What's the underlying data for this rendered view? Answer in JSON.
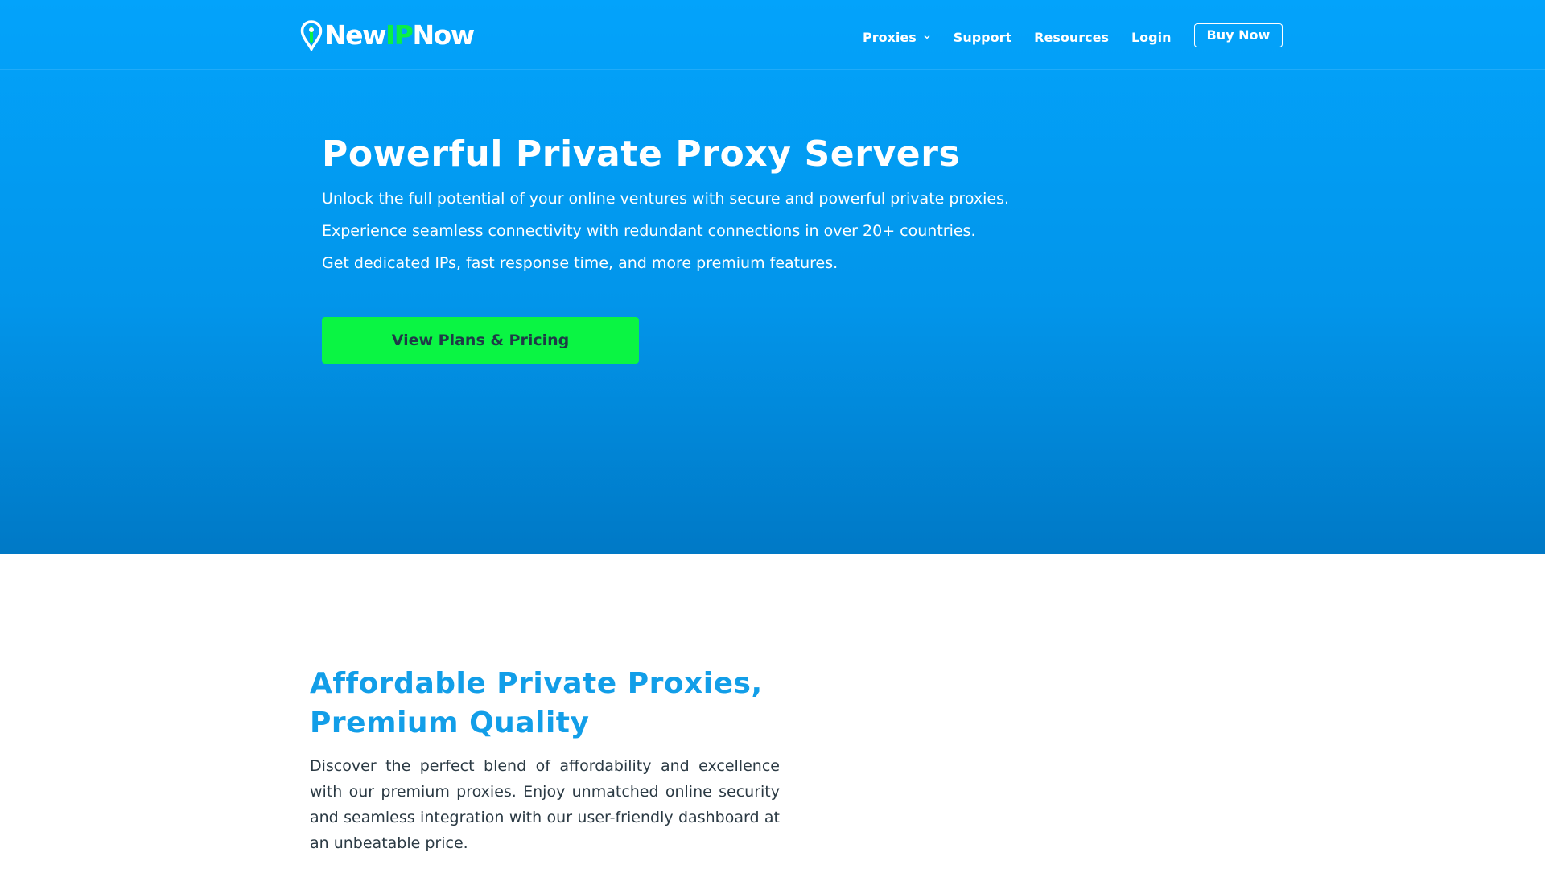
{
  "brand": {
    "name_prefix": "New",
    "name_highlight": "IP",
    "name_suffix": "Now",
    "icon": "map-pin-icon",
    "colors": {
      "primary": "#03a3fb",
      "accent": "#0aef46",
      "heading_blue": "#129ee8"
    }
  },
  "nav": {
    "items": [
      {
        "label": "Proxies",
        "has_dropdown": true
      },
      {
        "label": "Support"
      },
      {
        "label": "Resources"
      },
      {
        "label": "Login"
      }
    ],
    "buy_label": "Buy Now"
  },
  "hero": {
    "title": "Powerful Private Proxy Servers",
    "lines": [
      "Unlock the full potential of your online ventures with secure and powerful private proxies.",
      "Experience seamless connectivity with redundant connections in over 20+ countries.",
      "Get dedicated IPs, fast response time, and more premium features."
    ],
    "cta_label": "View Plans & Pricing"
  },
  "section": {
    "title": "Affordable Private Proxies, Premium Quality",
    "body": "Discover the perfect blend of affordability and excellence with our premium proxies. Enjoy unmatched online security and seamless integration with our user-friendly dashboard at an unbeatable price."
  }
}
